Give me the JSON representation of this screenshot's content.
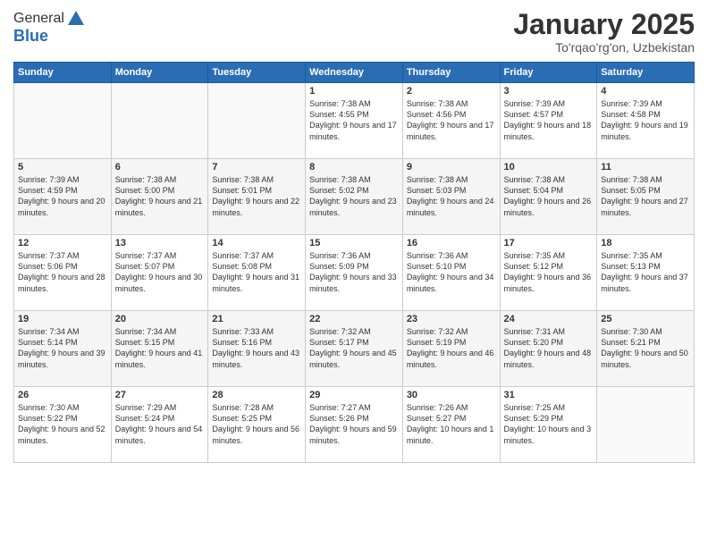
{
  "logo": {
    "general": "General",
    "blue": "Blue"
  },
  "header": {
    "month": "January 2025",
    "location": "To'rqao'rg'on, Uzbekistan"
  },
  "weekdays": [
    "Sunday",
    "Monday",
    "Tuesday",
    "Wednesday",
    "Thursday",
    "Friday",
    "Saturday"
  ],
  "weeks": [
    [
      {
        "day": "",
        "sunrise": "",
        "sunset": "",
        "daylight": ""
      },
      {
        "day": "",
        "sunrise": "",
        "sunset": "",
        "daylight": ""
      },
      {
        "day": "",
        "sunrise": "",
        "sunset": "",
        "daylight": ""
      },
      {
        "day": "1",
        "sunrise": "Sunrise: 7:38 AM",
        "sunset": "Sunset: 4:55 PM",
        "daylight": "Daylight: 9 hours and 17 minutes."
      },
      {
        "day": "2",
        "sunrise": "Sunrise: 7:38 AM",
        "sunset": "Sunset: 4:56 PM",
        "daylight": "Daylight: 9 hours and 17 minutes."
      },
      {
        "day": "3",
        "sunrise": "Sunrise: 7:39 AM",
        "sunset": "Sunset: 4:57 PM",
        "daylight": "Daylight: 9 hours and 18 minutes."
      },
      {
        "day": "4",
        "sunrise": "Sunrise: 7:39 AM",
        "sunset": "Sunset: 4:58 PM",
        "daylight": "Daylight: 9 hours and 19 minutes."
      }
    ],
    [
      {
        "day": "5",
        "sunrise": "Sunrise: 7:39 AM",
        "sunset": "Sunset: 4:59 PM",
        "daylight": "Daylight: 9 hours and 20 minutes."
      },
      {
        "day": "6",
        "sunrise": "Sunrise: 7:38 AM",
        "sunset": "Sunset: 5:00 PM",
        "daylight": "Daylight: 9 hours and 21 minutes."
      },
      {
        "day": "7",
        "sunrise": "Sunrise: 7:38 AM",
        "sunset": "Sunset: 5:01 PM",
        "daylight": "Daylight: 9 hours and 22 minutes."
      },
      {
        "day": "8",
        "sunrise": "Sunrise: 7:38 AM",
        "sunset": "Sunset: 5:02 PM",
        "daylight": "Daylight: 9 hours and 23 minutes."
      },
      {
        "day": "9",
        "sunrise": "Sunrise: 7:38 AM",
        "sunset": "Sunset: 5:03 PM",
        "daylight": "Daylight: 9 hours and 24 minutes."
      },
      {
        "day": "10",
        "sunrise": "Sunrise: 7:38 AM",
        "sunset": "Sunset: 5:04 PM",
        "daylight": "Daylight: 9 hours and 26 minutes."
      },
      {
        "day": "11",
        "sunrise": "Sunrise: 7:38 AM",
        "sunset": "Sunset: 5:05 PM",
        "daylight": "Daylight: 9 hours and 27 minutes."
      }
    ],
    [
      {
        "day": "12",
        "sunrise": "Sunrise: 7:37 AM",
        "sunset": "Sunset: 5:06 PM",
        "daylight": "Daylight: 9 hours and 28 minutes."
      },
      {
        "day": "13",
        "sunrise": "Sunrise: 7:37 AM",
        "sunset": "Sunset: 5:07 PM",
        "daylight": "Daylight: 9 hours and 30 minutes."
      },
      {
        "day": "14",
        "sunrise": "Sunrise: 7:37 AM",
        "sunset": "Sunset: 5:08 PM",
        "daylight": "Daylight: 9 hours and 31 minutes."
      },
      {
        "day": "15",
        "sunrise": "Sunrise: 7:36 AM",
        "sunset": "Sunset: 5:09 PM",
        "daylight": "Daylight: 9 hours and 33 minutes."
      },
      {
        "day": "16",
        "sunrise": "Sunrise: 7:36 AM",
        "sunset": "Sunset: 5:10 PM",
        "daylight": "Daylight: 9 hours and 34 minutes."
      },
      {
        "day": "17",
        "sunrise": "Sunrise: 7:35 AM",
        "sunset": "Sunset: 5:12 PM",
        "daylight": "Daylight: 9 hours and 36 minutes."
      },
      {
        "day": "18",
        "sunrise": "Sunrise: 7:35 AM",
        "sunset": "Sunset: 5:13 PM",
        "daylight": "Daylight: 9 hours and 37 minutes."
      }
    ],
    [
      {
        "day": "19",
        "sunrise": "Sunrise: 7:34 AM",
        "sunset": "Sunset: 5:14 PM",
        "daylight": "Daylight: 9 hours and 39 minutes."
      },
      {
        "day": "20",
        "sunrise": "Sunrise: 7:34 AM",
        "sunset": "Sunset: 5:15 PM",
        "daylight": "Daylight: 9 hours and 41 minutes."
      },
      {
        "day": "21",
        "sunrise": "Sunrise: 7:33 AM",
        "sunset": "Sunset: 5:16 PM",
        "daylight": "Daylight: 9 hours and 43 minutes."
      },
      {
        "day": "22",
        "sunrise": "Sunrise: 7:32 AM",
        "sunset": "Sunset: 5:17 PM",
        "daylight": "Daylight: 9 hours and 45 minutes."
      },
      {
        "day": "23",
        "sunrise": "Sunrise: 7:32 AM",
        "sunset": "Sunset: 5:19 PM",
        "daylight": "Daylight: 9 hours and 46 minutes."
      },
      {
        "day": "24",
        "sunrise": "Sunrise: 7:31 AM",
        "sunset": "Sunset: 5:20 PM",
        "daylight": "Daylight: 9 hours and 48 minutes."
      },
      {
        "day": "25",
        "sunrise": "Sunrise: 7:30 AM",
        "sunset": "Sunset: 5:21 PM",
        "daylight": "Daylight: 9 hours and 50 minutes."
      }
    ],
    [
      {
        "day": "26",
        "sunrise": "Sunrise: 7:30 AM",
        "sunset": "Sunset: 5:22 PM",
        "daylight": "Daylight: 9 hours and 52 minutes."
      },
      {
        "day": "27",
        "sunrise": "Sunrise: 7:29 AM",
        "sunset": "Sunset: 5:24 PM",
        "daylight": "Daylight: 9 hours and 54 minutes."
      },
      {
        "day": "28",
        "sunrise": "Sunrise: 7:28 AM",
        "sunset": "Sunset: 5:25 PM",
        "daylight": "Daylight: 9 hours and 56 minutes."
      },
      {
        "day": "29",
        "sunrise": "Sunrise: 7:27 AM",
        "sunset": "Sunset: 5:26 PM",
        "daylight": "Daylight: 9 hours and 59 minutes."
      },
      {
        "day": "30",
        "sunrise": "Sunrise: 7:26 AM",
        "sunset": "Sunset: 5:27 PM",
        "daylight": "Daylight: 10 hours and 1 minute."
      },
      {
        "day": "31",
        "sunrise": "Sunrise: 7:25 AM",
        "sunset": "Sunset: 5:29 PM",
        "daylight": "Daylight: 10 hours and 3 minutes."
      },
      {
        "day": "",
        "sunrise": "",
        "sunset": "",
        "daylight": ""
      }
    ]
  ]
}
